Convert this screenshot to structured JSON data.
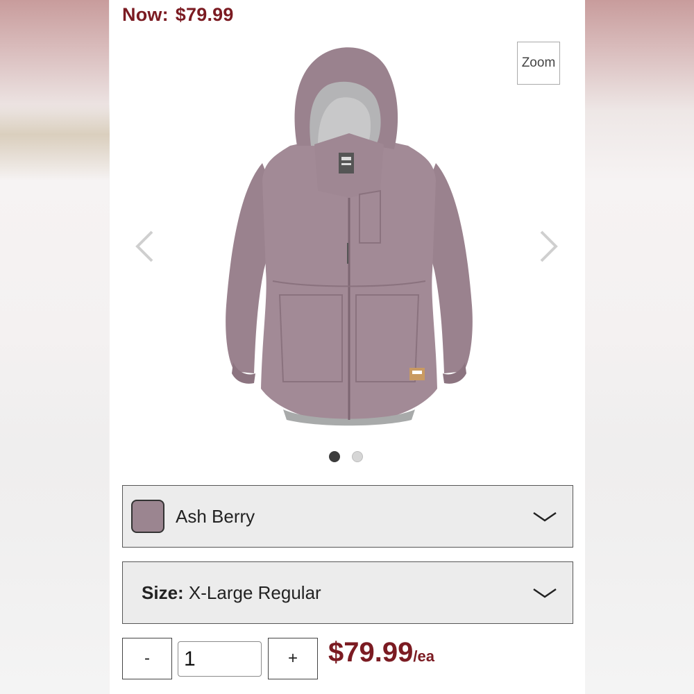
{
  "price_header": {
    "label": "Now:",
    "value": "$79.99"
  },
  "gallery": {
    "zoom_label": "Zoom",
    "slide_count": 2,
    "active_slide": 1,
    "image_alt": "Hooded rain jacket in Ash Berry"
  },
  "color_select": {
    "selected": "Ash Berry",
    "swatch_color": "#9b8590"
  },
  "size_select": {
    "label": "Size:",
    "selected": "X-Large Regular"
  },
  "quantity": {
    "minus_label": "-",
    "value": "1",
    "plus_label": "+"
  },
  "price": {
    "amount": "$79.99",
    "unit": "/ea"
  },
  "colors": {
    "accent": "#7b1b22",
    "jacket": "#9d8590"
  }
}
